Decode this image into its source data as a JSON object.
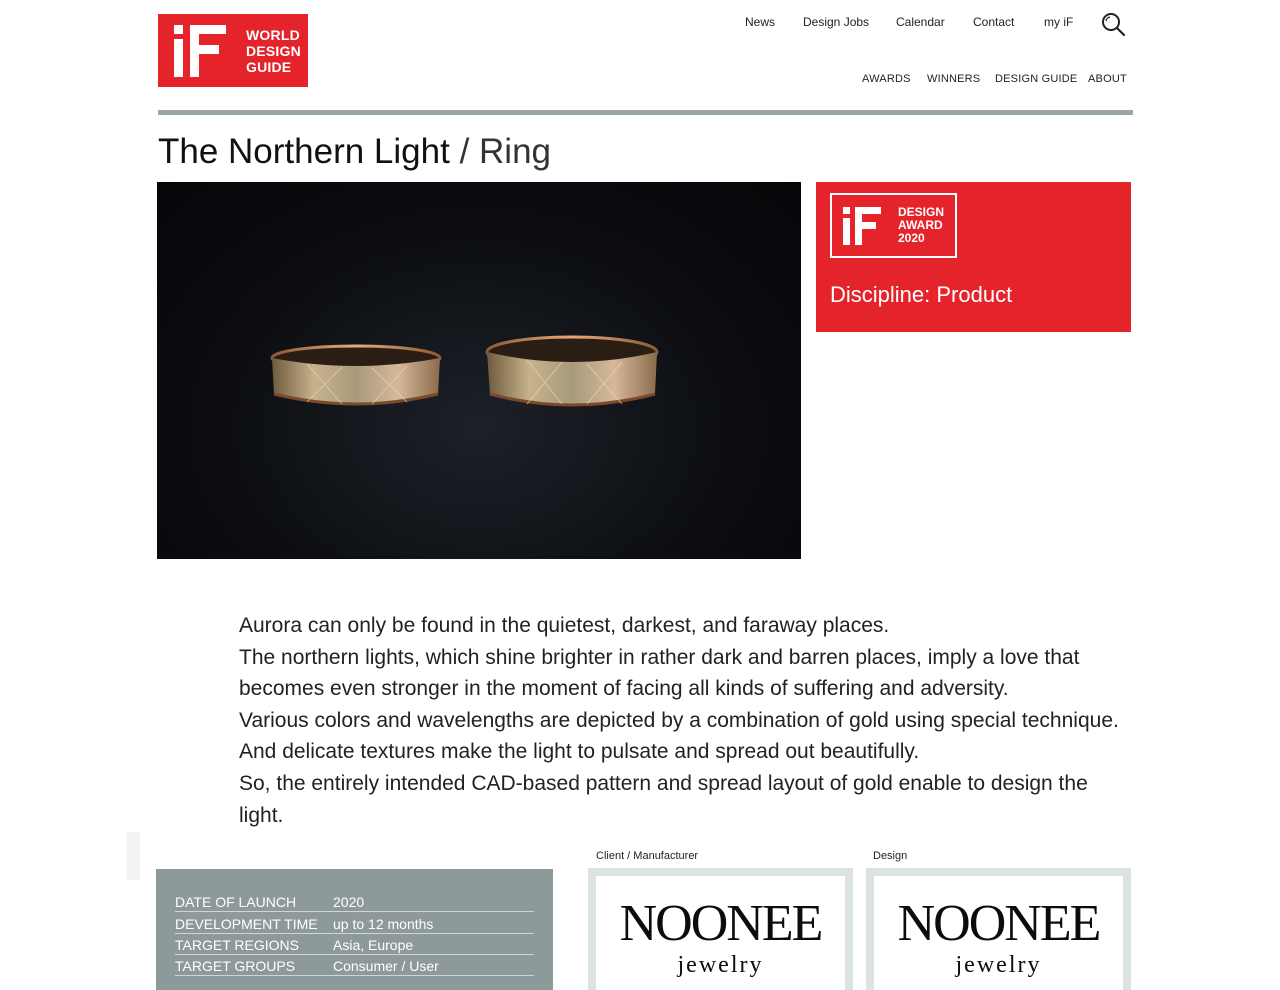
{
  "brand": {
    "logo_lines": [
      "WORLD",
      "DESIGN",
      "GUIDE"
    ],
    "accent": "#e4232b"
  },
  "top_nav": [
    "News",
    "Design Jobs",
    "Calendar",
    "Contact",
    "my iF"
  ],
  "main_nav": [
    "AWARDS",
    "WINNERS",
    "DESIGN GUIDE",
    "ABOUT"
  ],
  "page": {
    "title": "The Northern Light",
    "separator": "/",
    "category": "Ring"
  },
  "award": {
    "badge_lines": [
      "DESIGN",
      "AWARD",
      "2020"
    ],
    "discipline": "Discipline: Product"
  },
  "description": [
    "Aurora can only be found in the quietest, darkest, and faraway places.",
    "The northern lights, which shine brighter in rather dark and barren places, imply a love that becomes even stronger in the moment of facing all kinds of suffering and adversity.",
    "Various colors and wavelengths are depicted by a combination of gold using special technique. And delicate textures make the light to pulsate and spread out beautifully.",
    "So, the entirely intended CAD-based pattern and spread layout of gold enable to design the light."
  ],
  "facts": [
    {
      "label": "DATE OF LAUNCH",
      "value": "2020"
    },
    {
      "label": "DEVELOPMENT TIME",
      "value": "up to 12 months"
    },
    {
      "label": "TARGET REGIONS",
      "value": "Asia, Europe"
    },
    {
      "label": "TARGET GROUPS",
      "value": "Consumer / User"
    }
  ],
  "client": {
    "label": "Client / Manufacturer",
    "name": "NOONEE",
    "sub": "jewelry"
  },
  "designer": {
    "label": "Design",
    "name": "NOONEE",
    "sub": "jewelry"
  },
  "icons": {
    "search": "search-icon",
    "logo": "if-logo-icon"
  }
}
